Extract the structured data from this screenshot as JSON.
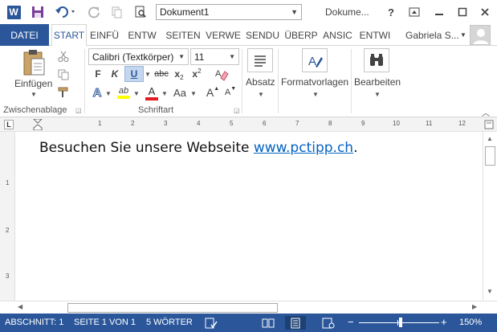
{
  "titlebar": {
    "app_logo": "W",
    "document_name": "Dokument1",
    "window_title": "Dokume...",
    "help": "?",
    "icons": {
      "save": "save-icon",
      "undo": "undo-icon",
      "redo": "redo-icon",
      "format": "format-painter-icon",
      "preview": "print-preview-icon",
      "ribbon_options": "ribbon-display-options-icon",
      "minimize": "minimize-icon",
      "maximize": "maximize-icon",
      "close": "close-icon"
    }
  },
  "tabs": {
    "file": "DATEI",
    "items": [
      "START",
      "EINFÜ",
      "ENTW",
      "SEITEN",
      "VERWE",
      "SENDU",
      "ÜBERP",
      "ANSIC",
      "ENTWI"
    ],
    "active": "START",
    "user_name": "Gabriela S...",
    "accent_color": "#2b579a"
  },
  "ribbon": {
    "clipboard": {
      "paste_label": "Einfügen",
      "group_label": "Zwischenablage"
    },
    "font": {
      "font_name": "Calibri (Textkörper)",
      "font_size": "11",
      "bold": "F",
      "italic": "K",
      "underline": "U",
      "strike": "abc",
      "subscript": "x",
      "subscript_mark": "2",
      "superscript": "x",
      "superscript_mark": "2",
      "text_effects": "A",
      "highlight": "ab",
      "font_color": "A",
      "change_case": "Aa",
      "grow": "A",
      "shrink": "A",
      "group_label": "Schriftart"
    },
    "paragraph_label": "Absatz",
    "styles_label": "Formatvorlagen",
    "editing_label": "Bearbeiten"
  },
  "ruler": {
    "tab_selector": "L",
    "top_labels": [
      "1",
      "2",
      "3",
      "4",
      "5",
      "6",
      "7",
      "8",
      "9",
      "10",
      "11",
      "12"
    ],
    "left_labels": [
      "1",
      "2",
      "3"
    ]
  },
  "document": {
    "text_before": "Besuchen Sie unsere Webseite ",
    "link_text": "www.pctipp.ch",
    "text_after": ".",
    "link_color": "#0563c1"
  },
  "statusbar": {
    "section": "ABSCHNITT: 1",
    "page": "SEITE 1 VON 1",
    "words": "5 WÖRTER",
    "zoom_minus": "−",
    "zoom_plus": "+",
    "zoom_level": "150%"
  }
}
